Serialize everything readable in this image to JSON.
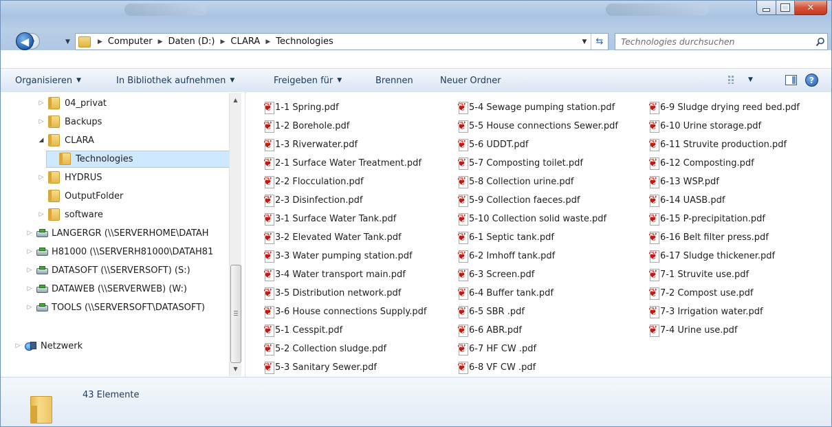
{
  "address": {
    "crumbs": [
      "Computer",
      "Daten (D:)",
      "CLARA",
      "Technologies"
    ],
    "search_placeholder": "Technologies durchsuchen"
  },
  "toolbar": {
    "organize": "Organisieren",
    "library": "In Bibliothek aufnehmen",
    "share": "Freigeben für",
    "burn": "Brennen",
    "new_folder": "Neuer Ordner"
  },
  "nav": {
    "items": [
      {
        "label": "04_privat",
        "kind": "folder",
        "expander": "collapsed"
      },
      {
        "label": "Backups",
        "kind": "folder",
        "expander": "collapsed"
      },
      {
        "label": "CLARA",
        "kind": "folder",
        "expander": "expanded"
      },
      {
        "label": "Technologies",
        "kind": "folder",
        "expander": "none",
        "selected": true
      },
      {
        "label": "HYDRUS",
        "kind": "folder",
        "expander": "collapsed"
      },
      {
        "label": "OutputFolder",
        "kind": "folder",
        "expander": "none"
      },
      {
        "label": "software",
        "kind": "folder",
        "expander": "collapsed"
      },
      {
        "label": "LANGERGR (\\\\SERVERHOME\\DATAH",
        "kind": "drive",
        "expander": "collapsed"
      },
      {
        "label": "H81000 (\\\\SERVERH81000\\DATAH81",
        "kind": "drive",
        "expander": "collapsed"
      },
      {
        "label": "DATASOFT (\\\\SERVERSOFT) (S:)",
        "kind": "drive",
        "expander": "collapsed"
      },
      {
        "label": "DATAWEB (\\\\SERVERWEB) (W:)",
        "kind": "drive",
        "expander": "collapsed"
      },
      {
        "label": "TOOLS (\\\\SERVERSOFT\\DATASOFT)",
        "kind": "drive",
        "expander": "collapsed"
      },
      {
        "label": "Netzwerk",
        "kind": "network",
        "expander": "collapsed"
      }
    ]
  },
  "files": {
    "col1": [
      "1-1 Spring.pdf",
      "1-2 Borehole.pdf",
      "1-3 Riverwater.pdf",
      "2-1 Surface Water Treatment.pdf",
      "2-2 Flocculation.pdf",
      "2-3 Disinfection.pdf",
      "3-1 Surface Water Tank.pdf",
      "3-2 Elevated Water Tank.pdf",
      "3-3 Water pumping station.pdf",
      "3-4 Water transport main.pdf",
      "3-5 Distribution network.pdf",
      "3-6 House connections Supply.pdf",
      "5-1 Cesspit.pdf",
      "5-2 Collection sludge.pdf",
      "5-3 Sanitary Sewer.pdf"
    ],
    "col2": [
      "5-4 Sewage pumping station.pdf",
      "5-5 House connections Sewer.pdf",
      "5-6 UDDT.pdf",
      "5-7 Composting toilet.pdf",
      "5-8 Collection urine.pdf",
      "5-9 Collection faeces.pdf",
      "5-10 Collection solid waste.pdf",
      "6-1 Septic tank.pdf",
      "6-2 Imhoff tank.pdf",
      "6-3 Screen.pdf",
      "6-4 Buffer tank.pdf",
      "6-5 SBR .pdf",
      "6-6 ABR.pdf",
      "6-7 HF CW .pdf",
      "6-8 VF CW .pdf"
    ],
    "col3": [
      "6-9 Sludge drying reed bed.pdf",
      "6-10 Urine storage.pdf",
      "6-11 Struvite production.pdf",
      "6-12 Composting.pdf",
      "6-13 WSP.pdf",
      "6-14 UASB.pdf",
      "6-15 P-precipitation.pdf",
      "6-16 Belt filter press.pdf",
      "6-17 Sludge thickener.pdf",
      "7-1 Struvite use.pdf",
      "7-2 Compost use.pdf",
      "7-3 Irrigation water.pdf",
      "7-4 Urine use.pdf"
    ]
  },
  "details": {
    "count": "43 Elemente"
  },
  "icons": {
    "file": "pdf-icon",
    "folder": "folder-icon",
    "drive": "network-drive-icon",
    "network": "network-icon",
    "search": "search-icon",
    "help": "help-icon",
    "refresh": "refresh-icon",
    "views": "views-icon",
    "preview": "preview-pane-icon"
  },
  "colors": {
    "selection": "#cde8ff",
    "close_button": "#c4381e",
    "pdf_red": "#c4170f",
    "command_text": "#1e395b"
  }
}
